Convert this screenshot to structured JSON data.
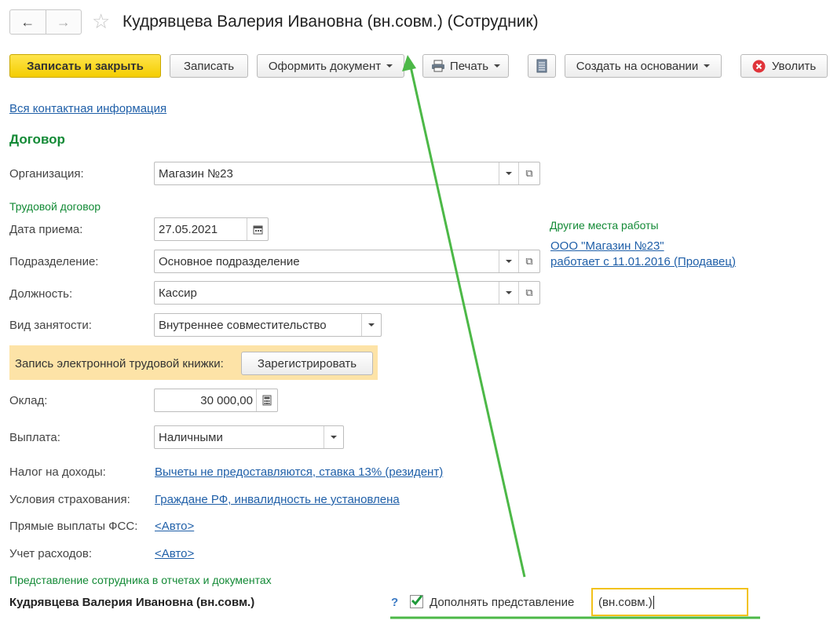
{
  "window": {
    "title": "Кудрявцева Валерия Ивановна (вн.совм.) (Сотрудник)"
  },
  "nav": {
    "back_icon": "arrow-left-icon",
    "forward_icon": "arrow-right-icon",
    "favorite_icon": "star-icon"
  },
  "toolbar": {
    "save_close": "Записать и закрыть",
    "save": "Записать",
    "make_document": "Оформить документ",
    "print": "Печать",
    "create_based": "Создать на основании",
    "dismiss": "Уволить"
  },
  "contact_link": "Вся контактная информация",
  "contract": {
    "heading": "Договор",
    "organization_label": "Организация:",
    "organization_value": "Магазин №23",
    "labor_heading": "Трудовой договор",
    "hire_date_label": "Дата приема:",
    "hire_date_value": "27.05.2021",
    "department_label": "Подразделение:",
    "department_value": "Основное подразделение",
    "position_label": "Должность:",
    "position_value": "Кассир",
    "employment_type_label": "Вид занятости:",
    "employment_type_value": "Внутреннее совместительство",
    "etk_label": "Запись электронной трудовой книжки:",
    "etk_button": "Зарегистрировать",
    "salary_label": "Оклад:",
    "salary_value": "30 000,00",
    "payment_label": "Выплата:",
    "payment_value": "Наличными",
    "tax_label": "Налог на доходы:",
    "tax_value": "Вычеты не предоставляются, ставка 13% (резидент)",
    "insurance_label": "Условия страхования:",
    "insurance_value": "Граждане РФ, инвалидность не установлена",
    "fss_label": "Прямые выплаты ФСС:",
    "fss_value": "<Авто>",
    "expenses_label": "Учет расходов:",
    "expenses_value": "<Авто>"
  },
  "other_jobs": {
    "heading": "Другие места работы",
    "line1": "ООО \"Магазин №23\"",
    "line2": "работает с 11.01.2016 (Продавец)"
  },
  "representation": {
    "heading": "Представление сотрудника в отчетах и документах",
    "name": "Кудрявцева Валерия Ивановна (вн.совм.)",
    "help": "?",
    "checkbox_label": "Дополнять представление",
    "checked": true,
    "input_value": "(вн.совм.)"
  },
  "colors": {
    "accent_green": "#138a36",
    "link_blue": "#1f5fa8",
    "annotation_green": "#4cb847",
    "highlight_yellow": "#f2c21b",
    "etk_background": "#fde3a7"
  }
}
